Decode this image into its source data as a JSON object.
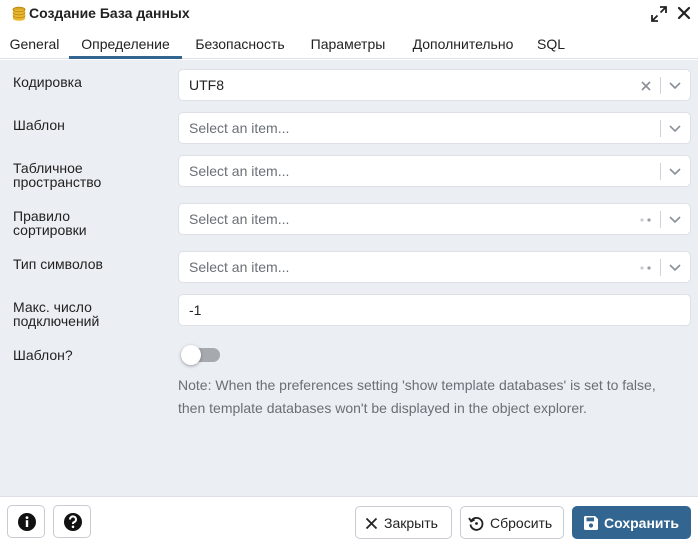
{
  "window": {
    "title": "Создание База данных",
    "icon": "database-icon",
    "controls": [
      "expand-icon",
      "close-icon"
    ]
  },
  "tabs": [
    {
      "label": "General"
    },
    {
      "label": "Определение",
      "active": true
    },
    {
      "label": "Безопасность"
    },
    {
      "label": "Параметры"
    },
    {
      "label": "Дополнительно"
    },
    {
      "label": "SQL"
    }
  ],
  "form": {
    "encoding": {
      "label": "Кодировка",
      "value": "UTF8"
    },
    "template": {
      "label": "Шаблон",
      "placeholder": "Select an item..."
    },
    "tablespace": {
      "label_line1": "Табличное",
      "label_line2": "пространство",
      "placeholder": "Select an item..."
    },
    "collation": {
      "label_line1": "Правило",
      "label_line2": "сортировки",
      "placeholder": "Select an item..."
    },
    "ctype": {
      "label": "Тип символов",
      "placeholder": "Select an item..."
    },
    "connlimit": {
      "label_line1": "Макс. число",
      "label_line2": "подключений",
      "value": "-1"
    },
    "is_template": {
      "label": "Шаблон?",
      "checked": false,
      "note_line1": "Note: When the preferences setting 'show template databases' is set to false,",
      "note_line2": "then template databases won't be displayed in the object explorer."
    }
  },
  "footer": {
    "info_icon": "info-icon",
    "help_icon": "help-icon",
    "close_label": "Закрыть",
    "reset_label": "Сбросить",
    "save_label": "Сохранить"
  },
  "colors": {
    "accent": "#326690",
    "content_bg": "#ebeef3"
  }
}
